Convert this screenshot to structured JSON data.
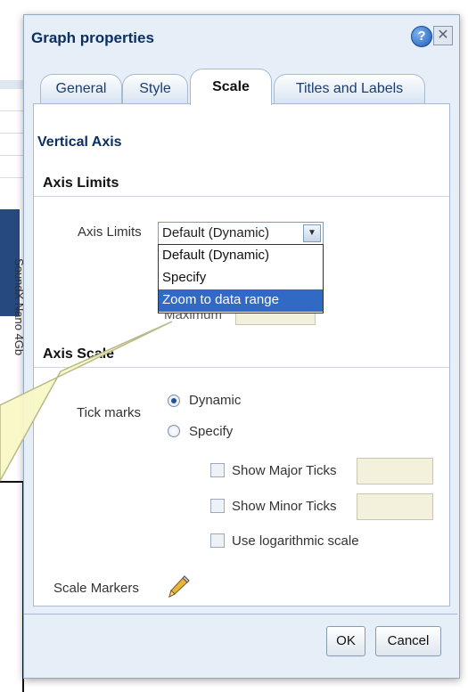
{
  "background": {
    "vertical_text": "SoundX Nano 4Gb"
  },
  "dialog": {
    "title": "Graph properties",
    "help_glyph": "?",
    "close_glyph": "✕",
    "tabs": [
      {
        "label": "General",
        "active": false
      },
      {
        "label": "Style",
        "active": false
      },
      {
        "label": "Scale",
        "active": true
      },
      {
        "label": "Titles and Labels",
        "active": false
      }
    ],
    "section_title": "Vertical Axis",
    "axis_limits": {
      "group_title": "Axis Limits",
      "label": "Axis Limits",
      "selected": "Default (Dynamic)",
      "options": [
        "Default (Dynamic)",
        "Specify",
        "Zoom to data range"
      ],
      "highlighted_option": "Zoom to data range",
      "maximum_label": "Maximum"
    },
    "axis_scale": {
      "group_title": "Axis Scale",
      "tick_marks_label": "Tick marks",
      "radio_dynamic": "Dynamic",
      "radio_specify": "Specify",
      "selected_radio": "Dynamic",
      "show_major_ticks": "Show Major Ticks",
      "show_minor_ticks": "Show Minor Ticks",
      "use_log_scale": "Use logarithmic scale",
      "scale_markers_label": "Scale Markers"
    },
    "buttons": {
      "ok": "OK",
      "cancel": "Cancel"
    }
  },
  "colors": {
    "title_blue": "#0b2f63",
    "dialog_bg": "#e6eef8",
    "highlight": "#316ac5",
    "callout_fill": "#f8f7c4"
  },
  "icons": {
    "help": "help-icon",
    "close": "close-icon",
    "dropdown": "chevron-down-icon",
    "scale_markers": "pencil-icon"
  }
}
